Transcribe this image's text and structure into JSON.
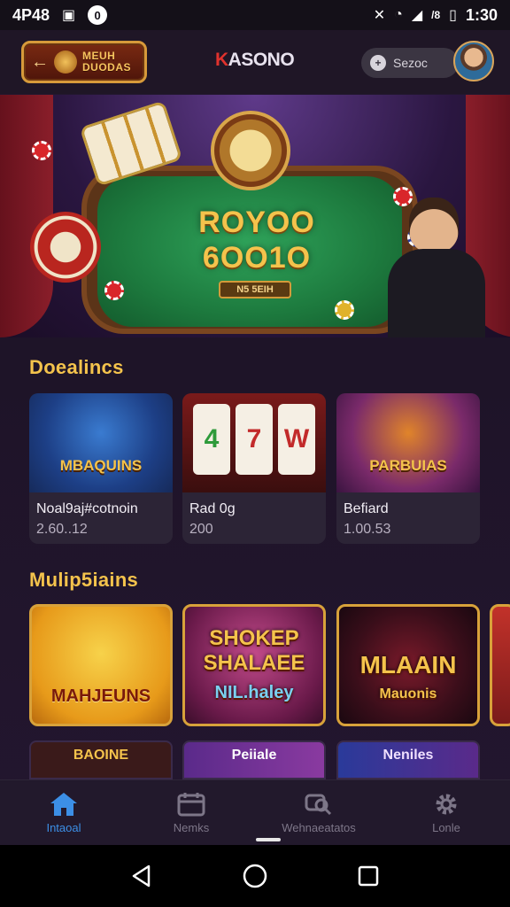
{
  "status_bar": {
    "carrier": "4P48",
    "notification_count": "0",
    "signal_text": "/8",
    "time": "1:30"
  },
  "header": {
    "logo_text": "MEUH DUODAS",
    "brand_prefix": "K",
    "brand_rest": "ASONO",
    "search_placeholder": "Sezoc"
  },
  "hero": {
    "title_line1": "ROYOO",
    "title_line2": "6OO1O",
    "button_label": "N5 5EIH"
  },
  "section1": {
    "title": "Doealincs",
    "cards": [
      {
        "title": "Noal9aj#cotnoin",
        "subtitle": "2.60..12",
        "thumb_text": "MBAQUINS"
      },
      {
        "title": "Rad 0g",
        "subtitle": "200",
        "thumb_text": "",
        "reels": [
          "4",
          "7",
          "W"
        ]
      },
      {
        "title": "Befiard",
        "subtitle": "1.00.53",
        "thumb_text": "PARBUIAS"
      }
    ]
  },
  "section2": {
    "title": "Mulip5iains",
    "tiles": [
      {
        "text": "MAHJEUNS"
      },
      {
        "text_line1": "SHOKEP",
        "text_line2": "SHALAEE",
        "text_line3": "NIL.haley"
      },
      {
        "text_line1": "MLAAIN",
        "text_line2": "Mauonis"
      }
    ],
    "row3": [
      "BAOINE",
      "Peiiale",
      "Neniles"
    ]
  },
  "bottom_nav": {
    "items": [
      {
        "label": "Intaoal",
        "icon": "home-icon",
        "active": true
      },
      {
        "label": "Nemks",
        "icon": "calendar-icon",
        "active": false
      },
      {
        "label": "Wehnaeatatos",
        "icon": "search-icon",
        "active": false
      },
      {
        "label": "Lonle",
        "icon": "gear-icon",
        "active": false
      }
    ]
  },
  "colors": {
    "accent_gold": "#f4c34c",
    "active_nav": "#3c8fe6",
    "background": "#1e1428"
  }
}
